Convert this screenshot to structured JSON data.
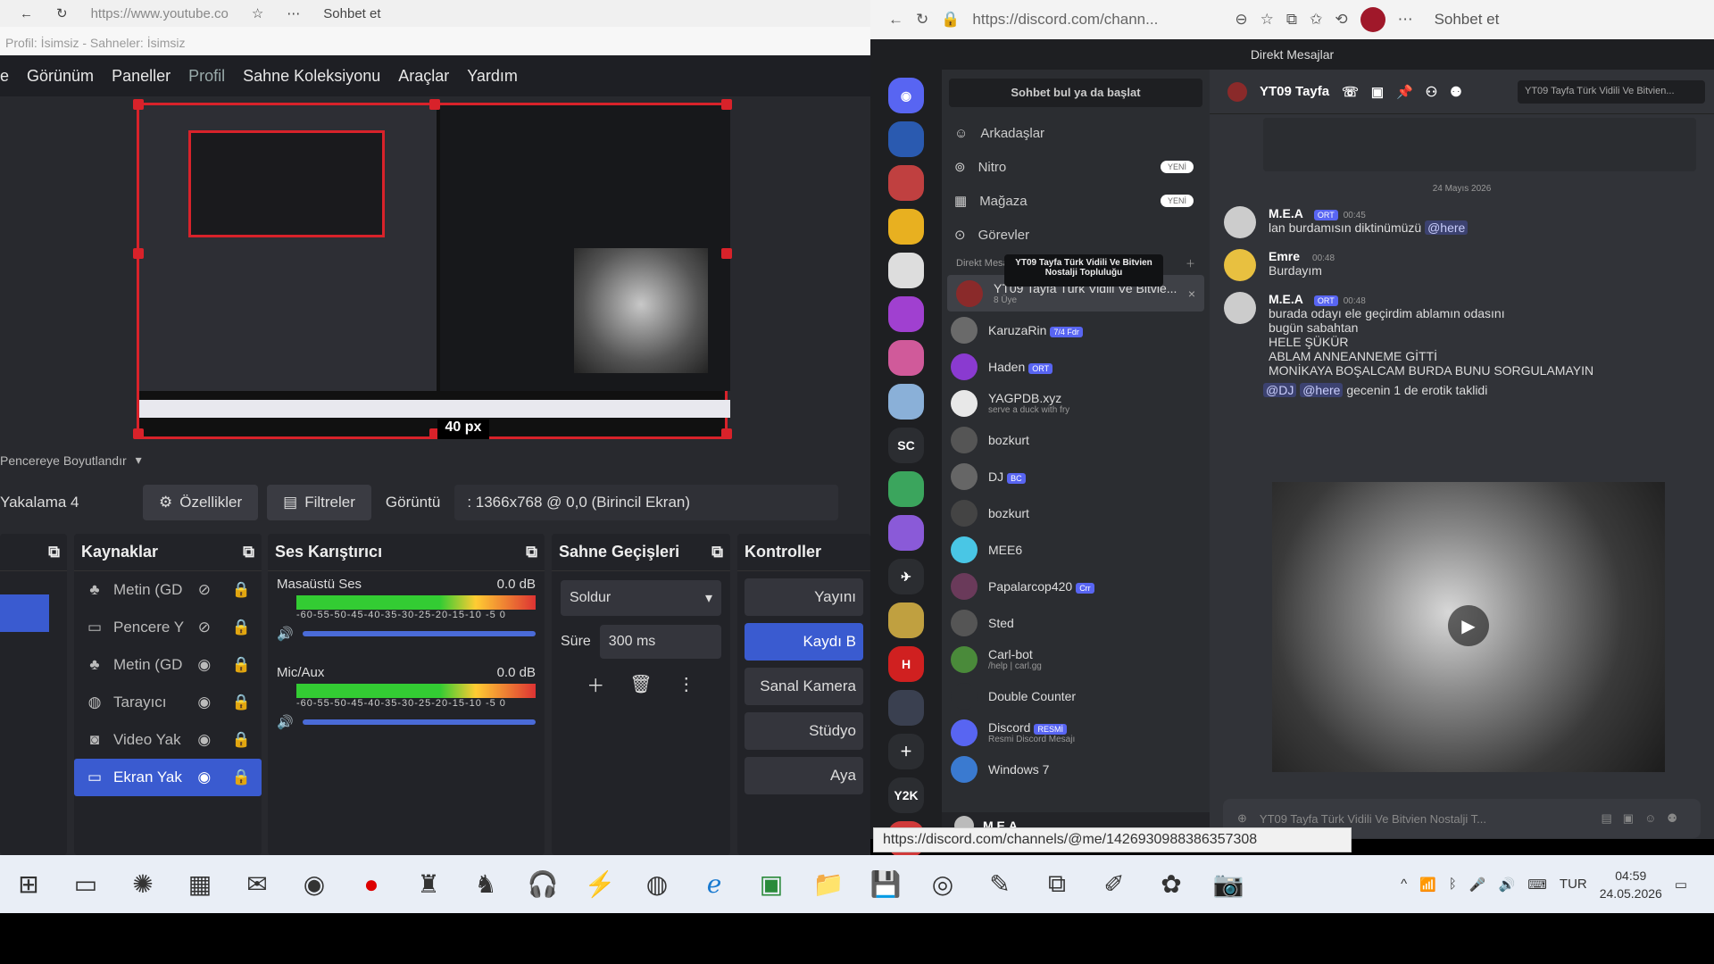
{
  "left_browser": {
    "url": "https://www.youtube.co",
    "copilot": "Sohbet et"
  },
  "obs": {
    "window_title": "Profil: İsimsiz - Sahneler: İsimsiz",
    "menu": [
      "e",
      "Görünüm",
      "Paneller",
      "Profil",
      "Sahne Koleksiyonu",
      "Araçlar",
      "Yardım"
    ],
    "px_label": "40 px",
    "resize_label": "Pencereye Boyutlandır",
    "scene_name": "Yakalama 4",
    "props_btn": "Özellikler",
    "filters_btn": "Filtreler",
    "display_label": "Görüntü",
    "display_value": ": 1366x768 @ 0,0 (Birincil Ekran)",
    "docks": {
      "sources_title": "Kaynaklar",
      "sources": [
        {
          "icon": "text-icon",
          "label": "Metin (GD",
          "visible": false
        },
        {
          "icon": "window-icon",
          "label": "Pencere Y",
          "visible": false
        },
        {
          "icon": "text-icon",
          "label": "Metin (GD",
          "visible": true
        },
        {
          "icon": "browser-icon",
          "label": "Tarayıcı",
          "visible": true
        },
        {
          "icon": "camera-icon",
          "label": "Video Yak",
          "visible": true
        },
        {
          "icon": "monitor-icon",
          "label": "Ekran Yak",
          "visible": true,
          "selected": true
        }
      ],
      "mixer_title": "Ses Karıştırıcı",
      "mixer": [
        {
          "name": "Masaüstü Ses",
          "db": "0.0 dB"
        },
        {
          "name": "Mic/Aux",
          "db": "0.0 dB"
        }
      ],
      "meter_scale": "-60-55-50-45-40-35-30-25-20-15-10 -5 0",
      "transitions_title": "Sahne Geçişleri",
      "transition_type": "Soldur",
      "duration_label": "Süre",
      "duration_value": "300 ms",
      "controls_title": "Kontroller",
      "controls": [
        {
          "label": "Yayını",
          "active": false
        },
        {
          "label": "Kaydı B",
          "active": true
        },
        {
          "label": "Sanal Kamera",
          "active": false
        },
        {
          "label": "Stüdyo",
          "active": false
        },
        {
          "label": "Aya",
          "active": false
        }
      ]
    }
  },
  "right_browser": {
    "url": "https://discord.com/chann...",
    "copilot": "Sohbet et"
  },
  "discord": {
    "window_title": "Direkt Mesajlar",
    "dm_search": "Sohbet bul ya da başlat",
    "nav": [
      {
        "icon": "friends-icon",
        "label": "Arkadaşlar",
        "pill": ""
      },
      {
        "icon": "nitro-icon",
        "label": "Nitro",
        "pill": "YENİ"
      },
      {
        "icon": "shop-icon",
        "label": "Mağaza",
        "pill": "YENİ"
      },
      {
        "icon": "quests-icon",
        "label": "Görevler",
        "pill": ""
      }
    ],
    "dm_header": "Direkt Mesajlar",
    "tooltip": "YT09 Tayfa Türk Vidili Ve Bitvien Nostalji Topluluğu",
    "dms": [
      {
        "name": "YT09 Tayfa Türk Vidili Ve Bitvie...",
        "sub": "8 Üye",
        "color": "#8a2a2a",
        "badge": "",
        "active": true
      },
      {
        "name": "KaruzaRin",
        "sub": "",
        "color": "#6a6a6a",
        "badge": "7/4 Fdr"
      },
      {
        "name": "Haden",
        "sub": "",
        "color": "#8a3ad0",
        "badge": "ORT"
      },
      {
        "name": "YAGPDB.xyz",
        "sub": "serve a duck with fry",
        "color": "#e8e8e8",
        "badge": ""
      },
      {
        "name": "bozkurt",
        "sub": "",
        "color": "#555",
        "badge": ""
      },
      {
        "name": "DJ",
        "sub": "",
        "color": "#666",
        "badge": "BC"
      },
      {
        "name": "bozkurt",
        "sub": "",
        "color": "#444",
        "badge": ""
      },
      {
        "name": "MEE6",
        "sub": "",
        "color": "#49c6e5",
        "badge": ""
      },
      {
        "name": "Papalarcop420",
        "sub": "",
        "color": "#6a3a5a",
        "badge": "Crr"
      },
      {
        "name": "Sted",
        "sub": "",
        "color": "#555",
        "badge": ""
      },
      {
        "name": "Carl-bot",
        "sub": "/help | carl.gg",
        "color": "#4a8a3a",
        "badge": ""
      },
      {
        "name": "Double Counter",
        "sub": "",
        "color": "#2b2d31",
        "badge": ""
      },
      {
        "name": "Discord",
        "sub": "Resmi Discord Mesajı",
        "color": "#5865f2",
        "badge": "RESMİ"
      },
      {
        "name": "Windows 7",
        "sub": "",
        "color": "#3a7ad0",
        "badge": ""
      }
    ],
    "user_name": "M.E.A",
    "channel_name": "YT09 Tayfa",
    "channel_search": "YT09 Tayfa Türk Vidili Ve Bitvien...",
    "date_divider": "24 Mayıs 2026",
    "messages": [
      {
        "author": "M.E.A",
        "tag": "ORT",
        "time": "00:45",
        "lines": [
          "lan burdamısın diktinümüzü"
        ],
        "mention": "@here",
        "avatar": "#ccc"
      },
      {
        "author": "Emre",
        "tag": "",
        "time": "00:48",
        "lines": [
          "Burdayım"
        ],
        "mention": "",
        "avatar": "#e8c040"
      },
      {
        "author": "M.E.A",
        "tag": "ORT",
        "time": "00:48",
        "lines": [
          "burada odayı ele geçirdim ablamın odasını",
          "bugün sabahtan",
          "HELE ŞÜKÜR",
          "ABLAM ANNEANNEME GİTTİ",
          "MONİKAYA BOŞALCAM BURDA BUNU SORGULAMAYIN"
        ],
        "mention": "",
        "avatar": "#ccc"
      }
    ],
    "last_line": {
      "m1": "@DJ",
      "m2": "@here",
      "text": "gecenin 1 de erotik taklidi"
    },
    "chat_placeholder": "YT09 Tayfa Türk Vidili Ve Bitvien Nostalji T...",
    "hover_url": "https://discord.com/channels/@me/1426930988386357308"
  },
  "taskbar": {
    "lang": "TUR",
    "time": "04:59",
    "date": "24.05.2026"
  }
}
